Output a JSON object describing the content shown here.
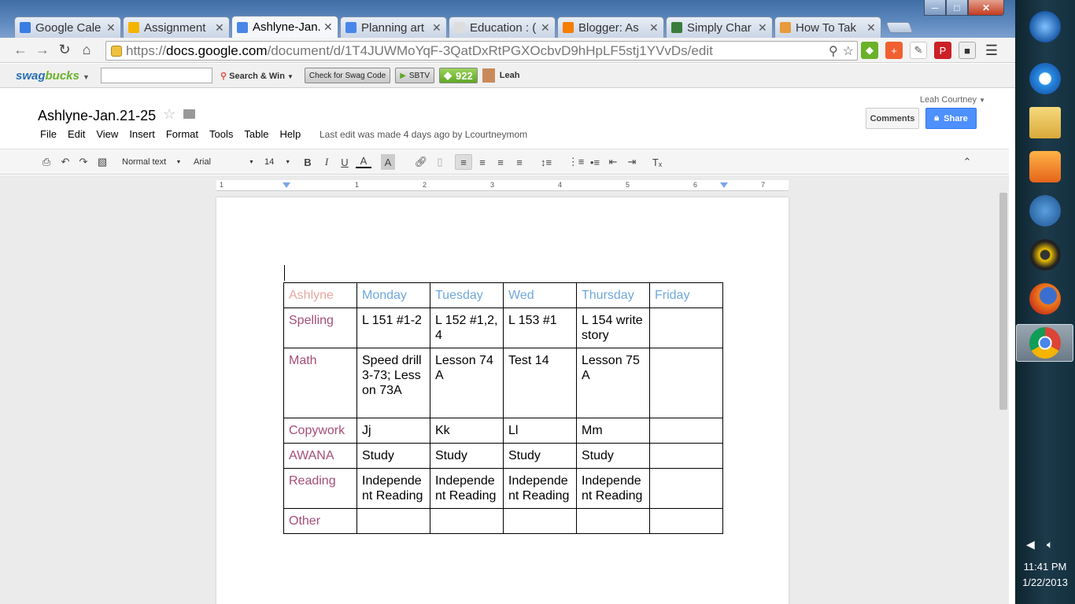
{
  "browser": {
    "tabs": [
      {
        "title": "Google Cale",
        "color": "#3b7be4"
      },
      {
        "title": "Assignment",
        "color": "#f4b400"
      },
      {
        "title": "Ashlyne-Jan.",
        "color": "#4a86e8",
        "active": true
      },
      {
        "title": "Planning art",
        "color": "#4a86e8"
      },
      {
        "title": "Education : (",
        "color": "#dddddd"
      },
      {
        "title": "Blogger: As",
        "color": "#f57d00"
      },
      {
        "title": "Simply Char",
        "color": "#3a7d3a"
      },
      {
        "title": "How To Tak",
        "color": "#e89a3c"
      }
    ],
    "url_prefix": "https://",
    "url_host": "docs.google.com",
    "url_path": "/document/d/1T4JUWMoYqF-3QatDxRtPGXOcbvD9hHpLF5stj1YVvDs/edit"
  },
  "swagbar": {
    "logo_a": "swag",
    "logo_b": "bucks",
    "search_win": "Search & Win",
    "check_code": "Check for Swag Code",
    "sbtv": "SBTV",
    "count": "922",
    "user": "Leah"
  },
  "doc": {
    "title": "Ashlyne-Jan.21-25",
    "menu": [
      "File",
      "Edit",
      "View",
      "Insert",
      "Format",
      "Tools",
      "Table",
      "Help"
    ],
    "last_edit": "Last edit was made 4 days ago by Lcourtneymom",
    "user": "Leah Courtney",
    "comments": "Comments",
    "share": "Share"
  },
  "format_bar": {
    "style": "Normal text",
    "font": "Arial",
    "size": "14"
  },
  "ruler": [
    "1",
    "1",
    "2",
    "3",
    "4",
    "5",
    "6",
    "7"
  ],
  "table": {
    "header": [
      "Ashlyne",
      "Monday",
      "Tuesday",
      "Wed",
      "Thursday",
      "Friday"
    ],
    "rows": [
      {
        "subject": "Spelling",
        "cells": [
          "L 151 #1-2",
          "L 152 #1,2,4",
          "L 153 #1",
          "L 154 write story",
          ""
        ]
      },
      {
        "subject": "Math",
        "cells": [
          "Speed drill 3-73; Lesson 73A",
          "Lesson 74A",
          "Test 14",
          "Lesson 75A",
          ""
        ]
      },
      {
        "subject": "Copywork",
        "cells": [
          "Jj",
          "Kk",
          "Ll",
          "Mm",
          ""
        ]
      },
      {
        "subject": "AWANA",
        "cells": [
          "Study",
          "Study",
          "Study",
          "Study",
          ""
        ]
      },
      {
        "subject": "Reading",
        "cells": [
          "Independent Reading",
          "Independent Reading",
          "Independent Reading",
          "Independent Reading",
          ""
        ]
      },
      {
        "subject": "Other",
        "cells": [
          "",
          "",
          "",
          "",
          ""
        ]
      }
    ]
  },
  "taskbar": {
    "time": "11:41 PM",
    "date": "1/22/2013"
  },
  "colors": {
    "student": "#e6a8a0",
    "day": "#6fa8dc",
    "subject": "#a64d79",
    "share": "#4d90fe"
  }
}
